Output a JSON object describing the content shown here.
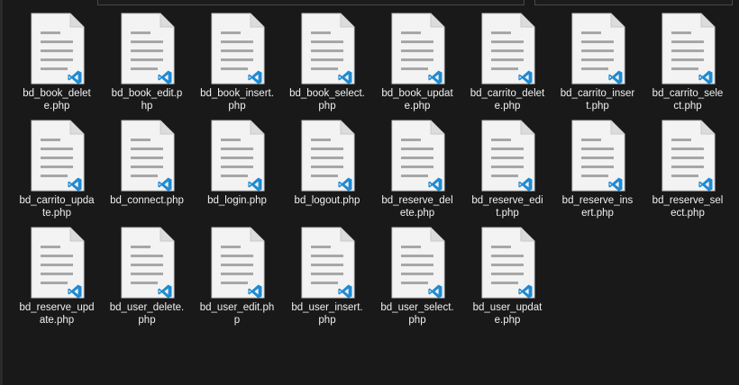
{
  "files": [
    {
      "name": "bd_book_delete.php",
      "icon": "vscode-php-file-icon"
    },
    {
      "name": "bd_book_edit.php",
      "icon": "vscode-php-file-icon"
    },
    {
      "name": "bd_book_insert.php",
      "icon": "vscode-php-file-icon"
    },
    {
      "name": "bd_book_select.php",
      "icon": "vscode-php-file-icon"
    },
    {
      "name": "bd_book_update.php",
      "icon": "vscode-php-file-icon"
    },
    {
      "name": "bd_carrito_delete.php",
      "icon": "vscode-php-file-icon"
    },
    {
      "name": "bd_carrito_insert.php",
      "icon": "vscode-php-file-icon"
    },
    {
      "name": "bd_carrito_select.php",
      "icon": "vscode-php-file-icon"
    },
    {
      "name": "bd_carrito_update.php",
      "icon": "vscode-php-file-icon"
    },
    {
      "name": "bd_connect.php",
      "icon": "vscode-php-file-icon"
    },
    {
      "name": "bd_login.php",
      "icon": "vscode-php-file-icon"
    },
    {
      "name": "bd_logout.php",
      "icon": "vscode-php-file-icon"
    },
    {
      "name": "bd_reserve_delete.php",
      "icon": "vscode-php-file-icon"
    },
    {
      "name": "bd_reserve_edit.php",
      "icon": "vscode-php-file-icon"
    },
    {
      "name": "bd_reserve_insert.php",
      "icon": "vscode-php-file-icon"
    },
    {
      "name": "bd_reserve_select.php",
      "icon": "vscode-php-file-icon"
    },
    {
      "name": "bd_reserve_update.php",
      "icon": "vscode-php-file-icon"
    },
    {
      "name": "bd_user_delete.php",
      "icon": "vscode-php-file-icon"
    },
    {
      "name": "bd_user_edit.php",
      "icon": "vscode-php-file-icon"
    },
    {
      "name": "bd_user_insert.php",
      "icon": "vscode-php-file-icon"
    },
    {
      "name": "bd_user_select.php",
      "icon": "vscode-php-file-icon"
    },
    {
      "name": "bd_user_update.php",
      "icon": "vscode-php-file-icon"
    }
  ],
  "colors": {
    "background": "#191919",
    "text": "#f0f0f0",
    "page": "#f3f3f3",
    "lines": "#a7a7a7",
    "vscode_blue": "#1f8ad2"
  }
}
